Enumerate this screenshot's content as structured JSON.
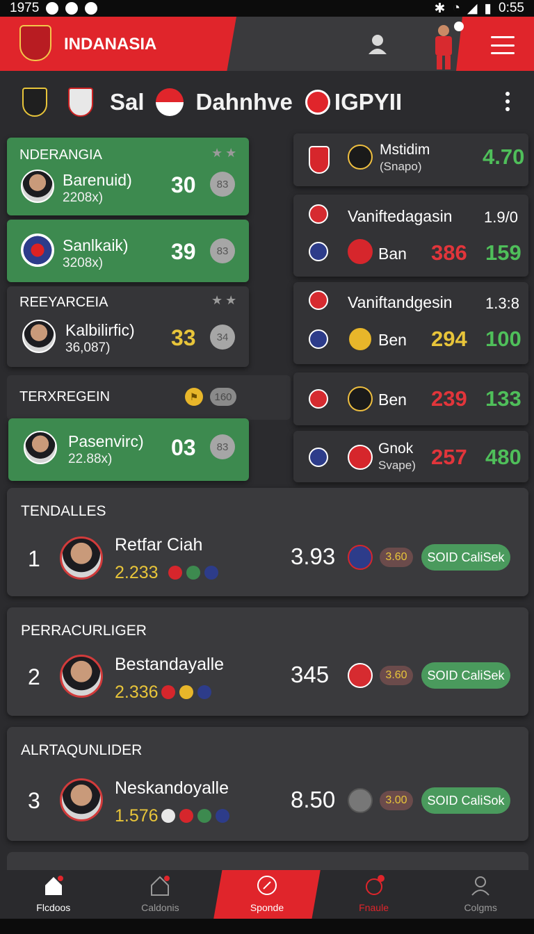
{
  "status_bar": {
    "time_left": "1975",
    "time_right": "0:55"
  },
  "header": {
    "brand": "INDANASIA"
  },
  "match_title": {
    "team_a": "Sal",
    "team_b": "Dahnhve",
    "tag": "IGPYII"
  },
  "left_cards": [
    {
      "heading": "NDERANGIA",
      "player": "Barenuid)",
      "sub": "2208x)",
      "score": "30",
      "badge": "83"
    },
    {
      "heading": "",
      "player": "Sanlkaik)",
      "sub": "3208x)",
      "score": "39",
      "badge": "83"
    },
    {
      "heading": "REEYARCEIA",
      "player": "Kalbilirfic)",
      "sub": "36,087)",
      "score": "33",
      "badge": "34"
    },
    {
      "heading": "TERXREGEIN",
      "badge_top": "160",
      "player": "Pasenvirc)",
      "sub": "22.88x)",
      "score": "03",
      "badge": "83"
    }
  ],
  "right_cards": {
    "r1": {
      "name": "Mstidim",
      "sub": "(Snapo)",
      "value": "4.70"
    },
    "r2": {
      "name": "Vaniftedagasin",
      "value": "1.9/0",
      "name2": "Ban",
      "num_a": "386",
      "num_b": "159"
    },
    "r3": {
      "name": "Vaniftandgesin",
      "value": "1.3:8",
      "name2": "Ben",
      "num_a": "294",
      "num_b": "100"
    },
    "r4": {
      "name2": "Ben",
      "num_a": "239",
      "num_b": "133"
    },
    "r5": {
      "name": "Gnok",
      "sub": "Svape)",
      "num_a": "257",
      "num_b": "480"
    }
  },
  "leaders": [
    {
      "heading": "TENDALLES",
      "rank": "1",
      "name": "Retfar Ciah",
      "value": "2.233",
      "score": "3.93",
      "odds": "3.60",
      "cta": "SOID CaliSek"
    },
    {
      "heading": "PERRACURLIGER",
      "rank": "2",
      "name": "Bestandayalle",
      "value": "2.336",
      "score": "345",
      "odds": "3.60",
      "cta": "SOID CaliSek"
    },
    {
      "heading": "ALRTAQUNLIDER",
      "rank": "3",
      "name": "Neskandoyalle",
      "value": "1.576",
      "score": "8.50",
      "odds": "3.00",
      "cta": "SOID CaliSok"
    }
  ],
  "bottom_nav": [
    {
      "label": "Flcdoos",
      "icon": "home-icon"
    },
    {
      "label": "Caldonis",
      "icon": "house-outline-icon"
    },
    {
      "label": "Sponde",
      "icon": "compass-icon"
    },
    {
      "label": "Fnaule",
      "icon": "trophy-icon"
    },
    {
      "label": "Colgms",
      "icon": "user-icon"
    }
  ],
  "colors": {
    "brand_red": "#e0252b",
    "card_green": "#3d8a4f",
    "accent_yellow": "#e8c53a",
    "accent_green": "#4fbf5a"
  }
}
